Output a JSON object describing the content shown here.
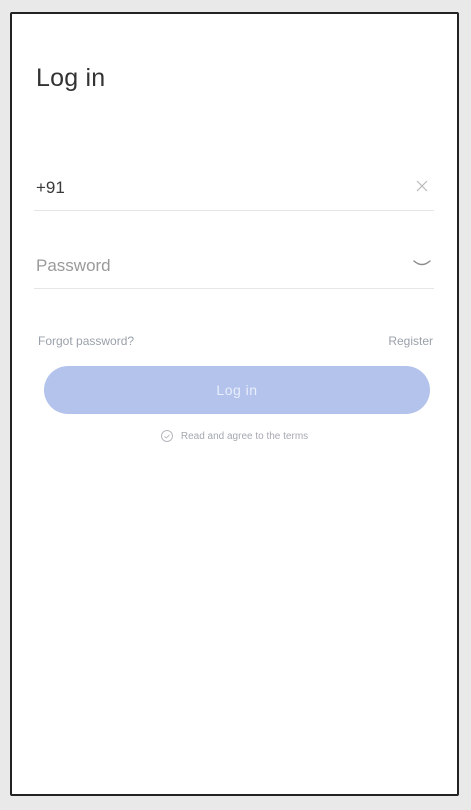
{
  "screen": {
    "title": "Log in"
  },
  "phone_field": {
    "value": "+91",
    "clear_icon": "close-icon"
  },
  "password_field": {
    "placeholder": "Password",
    "toggle_icon": "eye-closed-icon"
  },
  "links": {
    "forgot_password": "Forgot password?",
    "register": "Register"
  },
  "login_button": {
    "label": "Log in"
  },
  "agreement": {
    "text": "Read and agree to the terms",
    "icon": "check-circle-icon"
  },
  "colors": {
    "button_bg": "#b3c3ec",
    "button_text": "#e8eefb",
    "title_text": "#333333",
    "link_text": "#9aa0aa",
    "divider": "#e6e6e6"
  }
}
